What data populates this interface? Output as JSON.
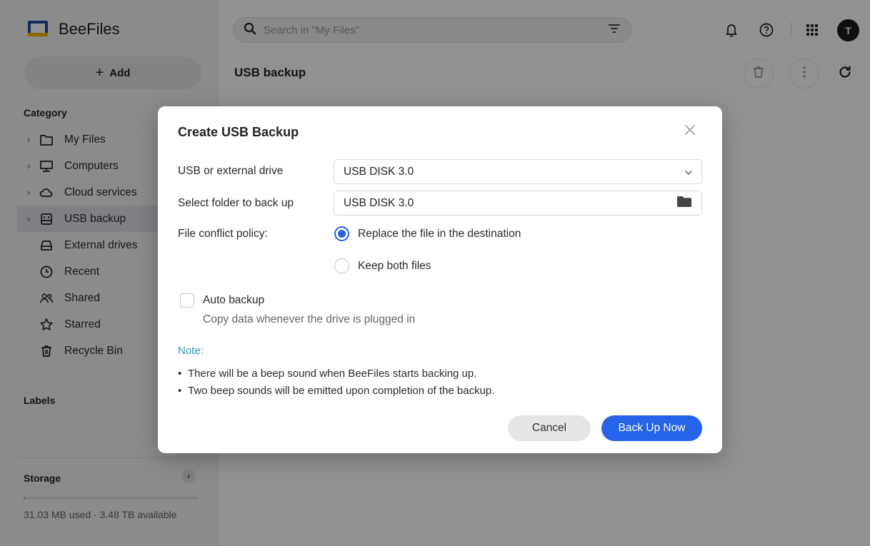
{
  "app": {
    "name": "BeeFiles",
    "add_label": "Add",
    "category_title": "Category",
    "labels_title": "Labels",
    "storage_title": "Storage",
    "storage_text": "31.03 MB used · 3.48 TB available",
    "storage_used_fraction": 0.01,
    "nav": [
      {
        "label": "My Files",
        "icon": "folder-icon",
        "chevron": true
      },
      {
        "label": "Computers",
        "icon": "monitor-icon",
        "chevron": true
      },
      {
        "label": "Cloud services",
        "icon": "cloud-icon",
        "chevron": true
      },
      {
        "label": "USB backup",
        "icon": "usb-drive-icon",
        "chevron": true,
        "active": true
      },
      {
        "label": "External drives",
        "icon": "external-drive-icon",
        "chevron": false
      },
      {
        "label": "Recent",
        "icon": "clock-icon",
        "chevron": false
      },
      {
        "label": "Shared",
        "icon": "users-icon",
        "chevron": false
      },
      {
        "label": "Starred",
        "icon": "star-icon",
        "chevron": false
      },
      {
        "label": "Recycle Bin",
        "icon": "trash-icon",
        "chevron": false
      }
    ]
  },
  "header": {
    "search_placeholder": "Search in \"My Files\"",
    "avatar_initial": "T",
    "page_title": "USB backup"
  },
  "modal": {
    "title": "Create USB Backup",
    "drive_label": "USB or external drive",
    "drive_value": "USB DISK 3.0",
    "folder_label": "Select folder to back up",
    "folder_value": "USB DISK 3.0",
    "conflict_label": "File conflict policy:",
    "conflict_options": [
      {
        "label": "Replace the file in the destination",
        "checked": true
      },
      {
        "label": "Keep both files",
        "checked": false
      }
    ],
    "auto_backup_label": "Auto backup",
    "auto_backup_checked": false,
    "auto_backup_desc": "Copy data whenever the drive is plugged in",
    "note_title": "Note:",
    "notes": [
      "There will be a beep sound when BeeFiles starts backing up.",
      "Two beep sounds will be emitted upon completion of the backup."
    ],
    "cancel_label": "Cancel",
    "confirm_label": "Back Up Now"
  },
  "colors": {
    "accent": "#2563eb",
    "note": "#2a9ab0",
    "logo_blue": "#1e4a9e",
    "logo_yellow": "#f5b700"
  }
}
